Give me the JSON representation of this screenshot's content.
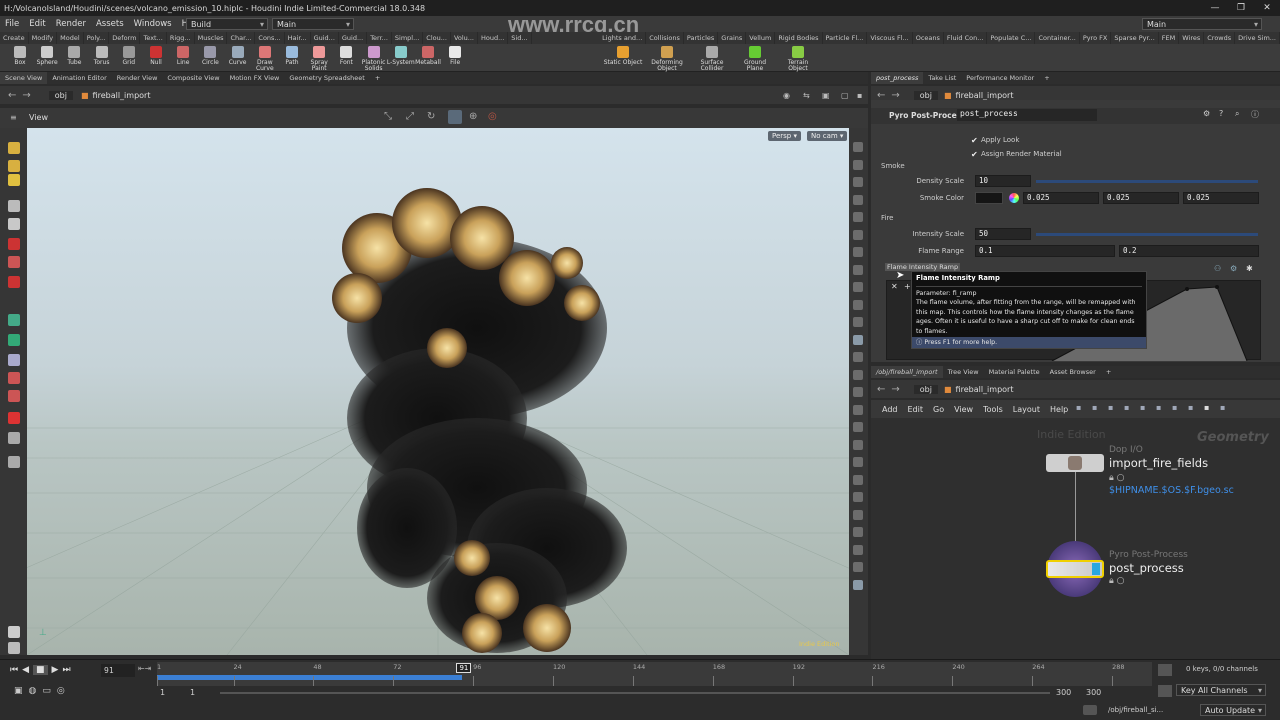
{
  "window": {
    "title": "H:/VolcanoIsland/Houdini/scenes/volcano_emission_10.hiplc - Houdini Indie Limited-Commercial 18.0.348",
    "controls": [
      "—",
      "❐",
      "✕"
    ]
  },
  "watermark": {
    "site": "www.rrcg.cn"
  },
  "menu": {
    "items": [
      "File",
      "Edit",
      "Render",
      "Assets",
      "Windows",
      "Help"
    ],
    "desktop": "Build",
    "main_left": "Main",
    "main_right": "Main"
  },
  "shelf": {
    "tabs_left": [
      "Create",
      "Modify",
      "Model",
      "Poly...",
      "Deform",
      "Text...",
      "Rigg...",
      "Muscles",
      "Char...",
      "Cons...",
      "Hair...",
      "Guid...",
      "Guid...",
      "Terr...",
      "Simpl...",
      "Clou...",
      "Volu...",
      "Houd...",
      "Sid..."
    ],
    "tabs_right": [
      "Lights and...",
      "Collisions",
      "Particles",
      "Grains",
      "Vellum",
      "Rigid Bodies",
      "Particle Fl...",
      "Viscous Fl...",
      "Oceans",
      "Fluid Con...",
      "Populate C...",
      "Container...",
      "Pyro FX",
      "Sparse Pyr...",
      "FEM",
      "Wires",
      "Crowds",
      "Drive Sim..."
    ],
    "tools_left": [
      "Box",
      "Sphere",
      "Tube",
      "Torus",
      "Grid",
      "Null",
      "Line",
      "Circle",
      "Curve",
      "Draw Curve",
      "Path",
      "Spray Paint",
      "Font",
      "Platonic Solids",
      "L-System",
      "Metaball",
      "File"
    ],
    "tools_right": [
      "Static Object",
      "Deforming Object",
      "Surface Collider",
      "Ground Plane",
      "Terrain Object"
    ]
  },
  "left_panel": {
    "tabs": [
      "Scene View",
      "Animation Editor",
      "Render View",
      "Composite View",
      "Motion FX View",
      "Geometry Spreadsheet"
    ],
    "path_root": "obj",
    "path_node": "fireball_import",
    "view_label": "View",
    "persp": "Persp ▾",
    "nocam": "No cam ▾",
    "indie_badge": "Indie Edition"
  },
  "parm_panel": {
    "tabs": [
      "post_process",
      "Take List",
      "Performance Monitor"
    ],
    "path_root": "obj",
    "path_node": "fireball_import",
    "node_type": "Pyro Post-Process",
    "node_name": "post_process",
    "apply_look": "Apply Look",
    "assign_material": "Assign Render Material",
    "smoke_section": "Smoke",
    "density_label": "Density Scale",
    "density_value": "10",
    "smoke_color_label": "Smoke Color",
    "smoke_color": [
      "0.025",
      "0.025",
      "0.025"
    ],
    "fire_section": "Fire",
    "intensity_label": "Intensity Scale",
    "intensity_value": "50",
    "flame_range_label": "Flame Range",
    "flame_range": [
      "0.1",
      "0.2"
    ],
    "ramp_label": "Flame Intensity Ramp"
  },
  "tooltip": {
    "title": "Flame Intensity Ramp",
    "parameter": "Parameter: fi_ramp",
    "body": "The flame volume, after fitting from the range, will be remapped with this map.  This controls how the flame intensity changes as the flame ages.  Often it is useful to have a sharp cut off to make for clean ends to flames.",
    "help": "Press F1 for more help."
  },
  "net_panel": {
    "tabs": [
      "/obj/fireball_import",
      "Tree View",
      "Material Palette",
      "Asset Browser"
    ],
    "path_root": "obj",
    "path_node": "fireball_import",
    "menu": [
      "Add",
      "Edit",
      "Go",
      "View",
      "Tools",
      "Layout",
      "Help"
    ],
    "indie_label": "Indie Edition",
    "context_label": "Geometry",
    "nodes": [
      {
        "type": "Dop I/O",
        "name": "import_fire_fields",
        "sub": "$HIPNAME.$OS.$F.bgeo.sc"
      },
      {
        "type": "Pyro Post-Process",
        "name": "post_process",
        "sub": ""
      }
    ]
  },
  "timeline": {
    "current_frame": "91",
    "ticks": [
      "1",
      "24",
      "48",
      "72",
      "96",
      "120",
      "144",
      "168",
      "192",
      "216",
      "240",
      "264",
      "288"
    ],
    "playhead": "91",
    "playhead_fraction": 0.307,
    "start": "1",
    "start2": "1",
    "end": "300",
    "end2": "300",
    "keys_info": "0 keys, 0/0 channels",
    "key_all": "Key All Channels",
    "status_path": "/obj/fireball_si...",
    "auto_update": "Auto Update"
  }
}
